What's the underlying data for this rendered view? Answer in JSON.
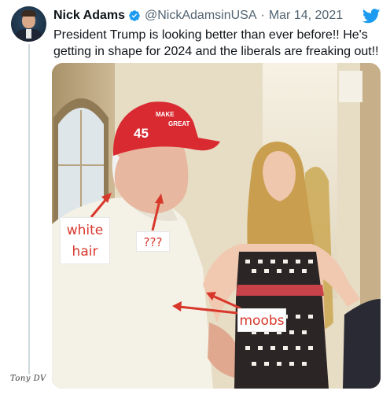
{
  "tweet": {
    "display_name": "Nick Adams",
    "handle": "@NickAdamsinUSA",
    "separator": "·",
    "date": "Mar 14, 2021",
    "text": "President Trump is looking better than ever before!! He's getting in shape for 2024 and the liberals are freaking out!!",
    "verified": true,
    "icons": {
      "avatar": "user-avatar",
      "verified": "verified-badge-icon",
      "brand": "twitter-bird-icon"
    }
  },
  "photo": {
    "annotations": {
      "white_hair": "white hair",
      "question": "???",
      "moobs": "moobs"
    },
    "cap_text": [
      "MAKE",
      "GREAT",
      "45"
    ]
  },
  "signature": "Tony DV",
  "colors": {
    "accent": "#1d9bf0",
    "annotation": "#d8382c",
    "cap": "#d92a32"
  }
}
